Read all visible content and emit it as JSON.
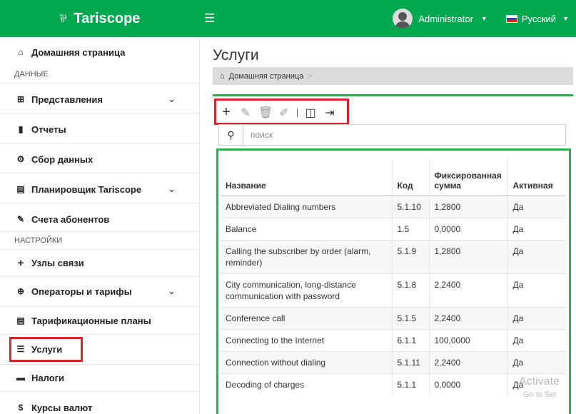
{
  "header": {
    "brand": "Tariscope",
    "brand_icon": "tariscope-logo",
    "menu_icon": "hamburger-icon",
    "user": "Administrator",
    "language": "Русский"
  },
  "sidebar": {
    "home": "Домашняя страница",
    "section_data": "ДАННЫЕ",
    "views": "Представления",
    "reports": "Отчеты",
    "collection": "Сбор данных",
    "scheduler": "Планировщик Tariscope",
    "accounts": "Счета абонентов",
    "section_settings": "НАСТРОЙКИ",
    "nodes": "Узлы связи",
    "operators": "Операторы и тарифы",
    "plans": "Тарификационные планы",
    "services": "Услуги",
    "taxes": "Налоги",
    "currency": "Курсы валют"
  },
  "main": {
    "title": "Услуги",
    "breadcrumb_home": "Домашняя страница",
    "breadcrumb_sep": ">",
    "search_placeholder": "поиск",
    "table": {
      "headers": [
        "Название",
        "Код",
        "Фиксированная сумма",
        "Активная"
      ],
      "rows": [
        {
          "name": "Abbreviated Dialing numbers",
          "code": "5.1.10",
          "amount": "1,2800",
          "active": "Да"
        },
        {
          "name": "Balance",
          "code": "1.5",
          "amount": "0,0000",
          "active": "Да"
        },
        {
          "name": "Calling the subscriber by order (alarm, reminder)",
          "code": "5.1.9",
          "amount": "1,2800",
          "active": "Да"
        },
        {
          "name": "City communication, long-distance communication with password",
          "code": "5.1.8",
          "amount": "2,2400",
          "active": "Да"
        },
        {
          "name": "Conference call",
          "code": "5.1.5",
          "amount": "2,2400",
          "active": "Да"
        },
        {
          "name": "Connecting to the Internet",
          "code": "6.1.1",
          "amount": "100,0000",
          "active": "Да"
        },
        {
          "name": "Connection without dialing",
          "code": "5.1.11",
          "amount": "2,2400",
          "active": "Да"
        },
        {
          "name": "Decoding of charges",
          "code": "5.1.1",
          "amount": "0,0000",
          "active": "Да"
        }
      ]
    }
  },
  "watermark": {
    "line1": "Activate",
    "line2": "Go to Set"
  },
  "colors": {
    "header_green": "#00a84f",
    "highlight_red": "#e0202a",
    "panel_green": "#2eae50"
  }
}
